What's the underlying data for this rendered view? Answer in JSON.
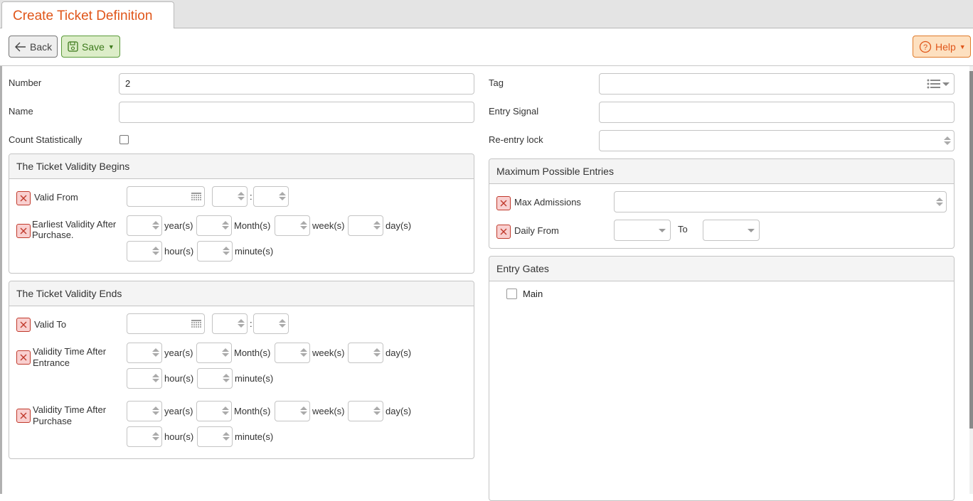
{
  "tab": {
    "title": "Create Ticket Definition"
  },
  "toolbar": {
    "back_label": "Back",
    "save_label": "Save",
    "help_label": "Help"
  },
  "form": {
    "number": {
      "label": "Number",
      "value": "2"
    },
    "name": {
      "label": "Name",
      "value": ""
    },
    "count_statistically": {
      "label": "Count Statistically",
      "checked": false
    },
    "tag": {
      "label": "Tag",
      "value": ""
    },
    "entry_signal": {
      "label": "Entry Signal",
      "value": ""
    },
    "reentry_lock": {
      "label": "Re-entry lock",
      "value": ""
    }
  },
  "units": {
    "year": "year(s)",
    "month": "Month(s)",
    "week": "week(s)",
    "day": "day(s)",
    "hour": "hour(s)",
    "minute": "minute(s)",
    "colon": ":"
  },
  "validity_begins": {
    "title": "The Ticket Validity Begins",
    "valid_from": {
      "label": "Valid From",
      "date": "",
      "hour": "",
      "minute": ""
    },
    "earliest_after_purchase": {
      "label": "Earliest Validity After Purchase."
    }
  },
  "validity_ends": {
    "title": "The Ticket Validity Ends",
    "valid_to": {
      "label": "Valid To",
      "date": "",
      "hour": "",
      "minute": ""
    },
    "after_entrance": {
      "label": "Validity Time After Entrance"
    },
    "after_purchase": {
      "label": "Validity Time After Purchase"
    }
  },
  "max_entries": {
    "title": "Maximum Possible Entries",
    "max_admissions": {
      "label": "Max Admissions",
      "value": ""
    },
    "daily_from": {
      "label": "Daily From",
      "from_value": "",
      "to_label": "To",
      "to_value": ""
    }
  },
  "entry_gates": {
    "title": "Entry Gates",
    "gates": [
      {
        "label": "Main",
        "checked": false
      }
    ]
  }
}
